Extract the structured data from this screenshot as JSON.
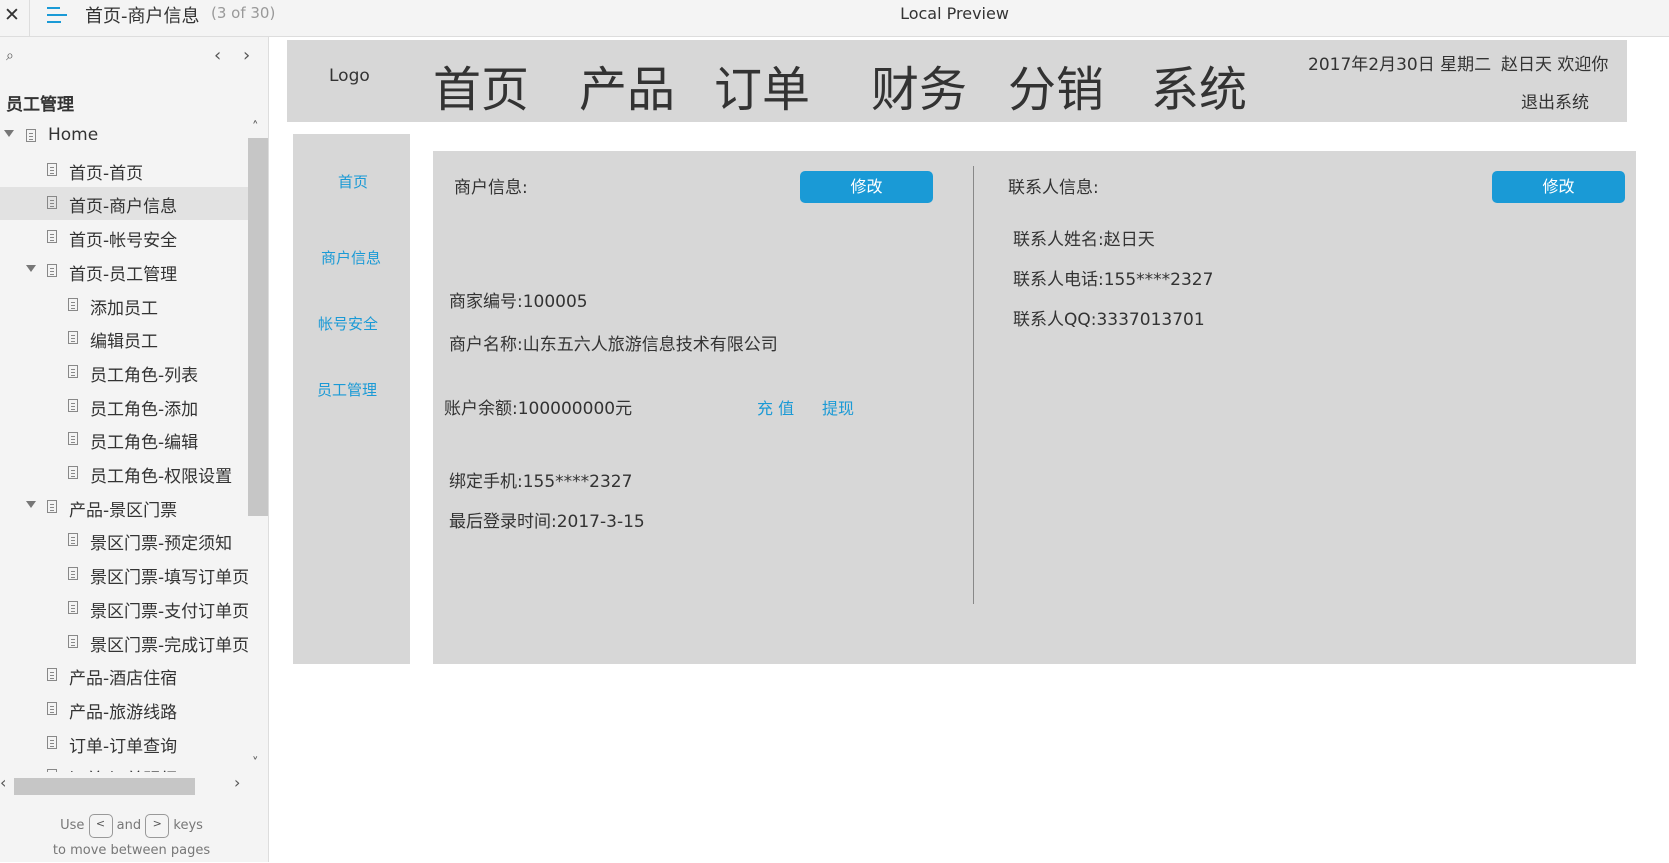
{
  "viewer": {
    "close_glyph": "✕",
    "page_name": "首页-商户信息",
    "page_count": "(3 of 30)",
    "preview_title": "Local Preview",
    "sidebar_title": "员工管理",
    "tree": [
      {
        "label": "Home",
        "level": 0,
        "expanded": true,
        "selected": false
      },
      {
        "label": "首页-首页",
        "level": 1,
        "expanded": false,
        "selected": false
      },
      {
        "label": "首页-商户信息",
        "level": 1,
        "expanded": false,
        "selected": true
      },
      {
        "label": "首页-帐号安全",
        "level": 1,
        "expanded": false,
        "selected": false
      },
      {
        "label": "首页-员工管理",
        "level": 1,
        "expanded": true,
        "selected": false
      },
      {
        "label": "添加员工",
        "level": 2,
        "expanded": false,
        "selected": false
      },
      {
        "label": "编辑员工",
        "level": 2,
        "expanded": false,
        "selected": false
      },
      {
        "label": "员工角色-列表",
        "level": 2,
        "expanded": false,
        "selected": false
      },
      {
        "label": "员工角色-添加",
        "level": 2,
        "expanded": false,
        "selected": false
      },
      {
        "label": "员工角色-编辑",
        "level": 2,
        "expanded": false,
        "selected": false
      },
      {
        "label": "员工角色-权限设置",
        "level": 2,
        "expanded": false,
        "selected": false
      },
      {
        "label": "产品-景区门票",
        "level": 1,
        "expanded": true,
        "selected": false
      },
      {
        "label": "景区门票-预定须知",
        "level": 2,
        "expanded": false,
        "selected": false
      },
      {
        "label": "景区门票-填写订单页",
        "level": 2,
        "expanded": false,
        "selected": false
      },
      {
        "label": "景区门票-支付订单页",
        "level": 2,
        "expanded": false,
        "selected": false
      },
      {
        "label": "景区门票-完成订单页",
        "level": 2,
        "expanded": false,
        "selected": false
      },
      {
        "label": "产品-酒店住宿",
        "level": 1,
        "expanded": false,
        "selected": false
      },
      {
        "label": "产品-旅游线路",
        "level": 1,
        "expanded": false,
        "selected": false
      },
      {
        "label": "订单-订单查询",
        "level": 1,
        "expanded": false,
        "selected": false
      },
      {
        "label": "订单-订单明细",
        "level": 1,
        "expanded": false,
        "selected": false
      }
    ],
    "help_use": "Use",
    "help_and": "and",
    "help_keys": "keys",
    "help_line2": "to move between pages",
    "key_prev": "<",
    "key_next": ">"
  },
  "app": {
    "logo": "Logo",
    "nav": [
      "首页",
      "产品",
      "订单",
      "财务",
      "分销",
      "系统"
    ],
    "date": "2017年2月30日 星期二",
    "greeting": "赵日天 欢迎你",
    "logout": "退出系统",
    "side_nav": [
      "首页",
      "商户信息",
      "帐号安全",
      "员工管理"
    ],
    "merchant": {
      "heading": "商户信息:",
      "edit": "修改",
      "id": "商家编号:100005",
      "name": "商户名称:山东五六人旅游信息技术有限公司",
      "balance": "账户余额:100000000元",
      "recharge": "充 值",
      "withdraw": "提现",
      "phone": "绑定手机:155****2327",
      "last_login": "最后登录时间:2017-3-15"
    },
    "contact": {
      "heading": "联系人信息:",
      "edit": "修改",
      "name": "联系人姓名:赵日天",
      "phone": "联系人电话:155****2327",
      "qq": "联系人QQ:3337013701"
    }
  },
  "colors": {
    "accent": "#1a9ad6",
    "panel": "#d7d7d7"
  }
}
